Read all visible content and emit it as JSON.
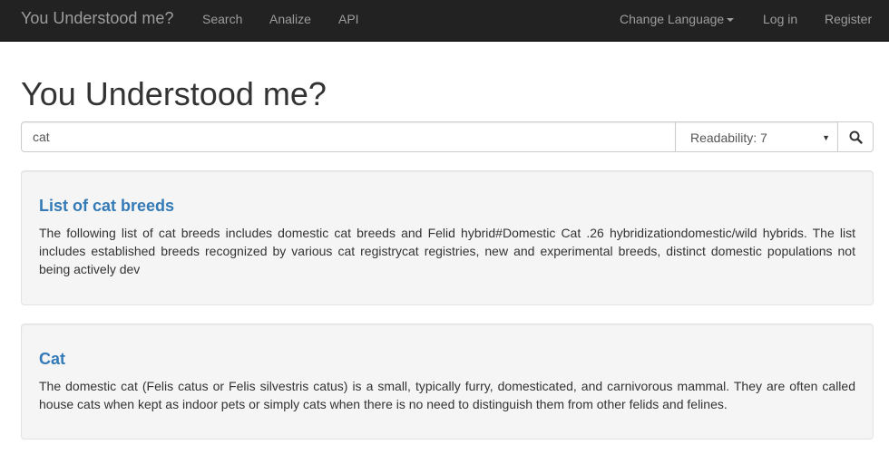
{
  "navbar": {
    "brand": "You Understood me?",
    "links": {
      "search": "Search",
      "analize": "Analize",
      "api": "API"
    },
    "right": {
      "language": "Change Language",
      "login": "Log in",
      "register": "Register"
    }
  },
  "main": {
    "title": "You Understood me?",
    "search": {
      "value": "cat",
      "readability": "Readability: 7",
      "button_icon": "search-icon"
    },
    "results": [
      {
        "title": "List of cat breeds",
        "snippet": "The following list of cat breeds includes domestic cat breeds and Felid hybrid#Domestic Cat .26 hybridizationdomestic/wild hybrids. The list includes established breeds recognized by various cat registrycat registries, new and experimental breeds, distinct domestic populations not being actively dev"
      },
      {
        "title": "Cat",
        "snippet": "The domestic cat (Felis catus or Felis silvestris catus) is a small, typically furry, domesticated, and carnivorous mammal. They are often called house cats when kept as indoor pets or simply cats when there is no need to distinguish them from other felids and felines."
      }
    ]
  },
  "colors": {
    "navbar_bg": "#222222",
    "navbar_text": "#9d9d9d",
    "link": "#337ab7",
    "card_bg": "#f5f5f5"
  }
}
